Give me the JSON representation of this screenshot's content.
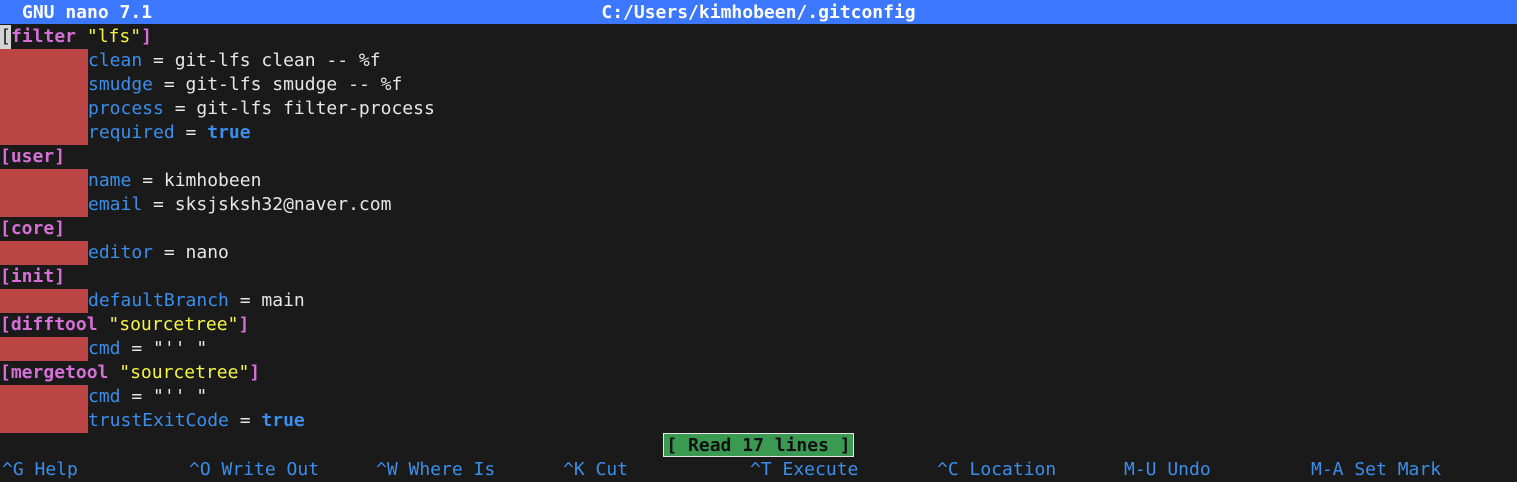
{
  "titlebar": {
    "app": "GNU nano 7.1",
    "file_path": "C:/Users/kimhobeen/.gitconfig"
  },
  "lines": [
    {
      "type": "section",
      "name": "filter",
      "sub": "\"lfs\"",
      "cursor": "["
    },
    {
      "type": "kv",
      "key": "clean",
      "value": "git-lfs clean -- %f"
    },
    {
      "type": "kv",
      "key": "smudge",
      "value": "git-lfs smudge -- %f"
    },
    {
      "type": "kv",
      "key": "process",
      "value": "git-lfs filter-process"
    },
    {
      "type": "kv",
      "key": "required",
      "value": "true",
      "bool": true
    },
    {
      "type": "section",
      "name": "user"
    },
    {
      "type": "kv",
      "key": "name",
      "value": "kimhobeen"
    },
    {
      "type": "kv",
      "key": "email",
      "value": "sksjsksh32@naver.com"
    },
    {
      "type": "section",
      "name": "core"
    },
    {
      "type": "kv",
      "key": "editor",
      "value": "nano"
    },
    {
      "type": "section",
      "name": "init"
    },
    {
      "type": "kv",
      "key": "defaultBranch",
      "value": "main"
    },
    {
      "type": "section",
      "name": "difftool",
      "sub": "\"sourcetree\""
    },
    {
      "type": "kv",
      "key": "cmd",
      "value": "\"'' \""
    },
    {
      "type": "section",
      "name": "mergetool",
      "sub": "\"sourcetree\""
    },
    {
      "type": "kv",
      "key": "cmd",
      "value": "\"'' \""
    },
    {
      "type": "kv",
      "key": "trustExitCode",
      "value": "true",
      "bool": true
    }
  ],
  "status": {
    "message": "[ Read 17 lines ]"
  },
  "shortcuts": [
    "^G Help",
    "^O Write Out",
    "^W Where Is",
    "^K Cut",
    "^T Execute",
    "^C Location",
    "M-U Undo",
    "M-A Set Mark"
  ],
  "colors": {
    "titlebar_bg": "#3b78ff",
    "editor_bg": "#1a1a1a",
    "section": "#d670d6",
    "subsection": "#f5f543",
    "key": "#3b8eea",
    "tab_highlight": "#bb4444",
    "status_bg": "#3a9a52"
  }
}
